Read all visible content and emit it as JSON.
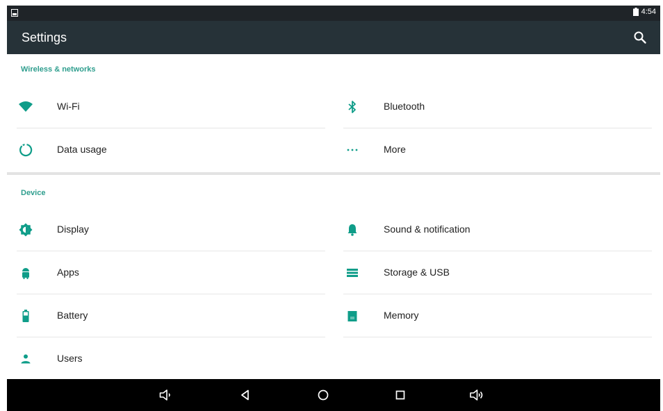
{
  "status_bar": {
    "time": "4:54",
    "left_icon": "screenshot-notification-icon",
    "battery_icon": "battery-icon"
  },
  "action_bar": {
    "title": "Settings",
    "search_icon": "search-icon"
  },
  "sections": [
    {
      "header": "Wireless & networks",
      "items": [
        {
          "label": "Wi-Fi",
          "icon": "wifi-icon"
        },
        {
          "label": "Bluetooth",
          "icon": "bluetooth-icon"
        },
        {
          "label": "Data usage",
          "icon": "data-usage-icon"
        },
        {
          "label": "More",
          "icon": "more-icon"
        }
      ]
    },
    {
      "header": "Device",
      "items": [
        {
          "label": "Display",
          "icon": "display-icon"
        },
        {
          "label": "Sound & notification",
          "icon": "bell-icon"
        },
        {
          "label": "Apps",
          "icon": "android-icon"
        },
        {
          "label": "Storage & USB",
          "icon": "storage-icon"
        },
        {
          "label": "Battery",
          "icon": "battery-icon"
        },
        {
          "label": "Memory",
          "icon": "memory-icon"
        },
        {
          "label": "Users",
          "icon": "user-icon"
        }
      ]
    }
  ],
  "nav_bar": {
    "buttons": [
      "volume-down-icon",
      "back-icon",
      "home-icon",
      "recents-icon",
      "volume-up-icon"
    ]
  },
  "colors": {
    "accent": "#2f9e8e",
    "icon_teal": "#0f9d89",
    "action_bar": "#263238",
    "status_bar": "#1f2428",
    "nav_bar": "#000000"
  }
}
